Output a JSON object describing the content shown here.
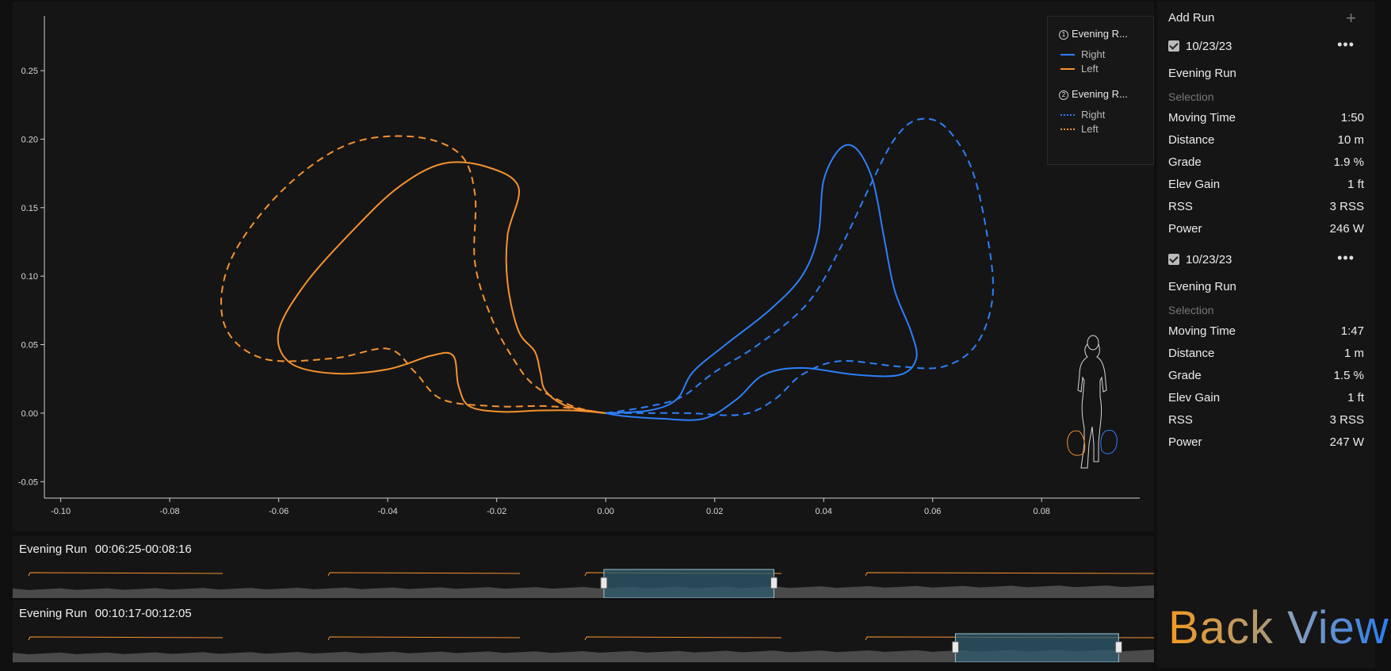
{
  "colors": {
    "right": "#2d7ff9",
    "left": "#f6922f",
    "background": "#0f0f10",
    "panel": "#151515"
  },
  "chart_data": {
    "type": "line",
    "xlim": [
      -0.103,
      0.098
    ],
    "ylim": [
      -0.062,
      0.29
    ],
    "x_ticks": [
      "-0.10",
      "-0.08",
      "-0.06",
      "-0.04",
      "-0.02",
      "0.00",
      "0.02",
      "0.04",
      "0.06",
      "0.08"
    ],
    "y_ticks": [
      "0.25",
      "0.20",
      "0.15",
      "0.10",
      "0.05",
      "0.00",
      "-0.05"
    ],
    "grid": false,
    "legend_position": "top-right",
    "series": [
      {
        "name": "Right",
        "group": "Evening R...",
        "run": 1,
        "dash": "solid",
        "color": "#2d7ff9",
        "points": [
          [
            0.0,
            0.0
          ],
          [
            0.008,
            0.002
          ],
          [
            0.013,
            0.01
          ],
          [
            0.016,
            0.03
          ],
          [
            0.022,
            0.05
          ],
          [
            0.03,
            0.075
          ],
          [
            0.036,
            0.1
          ],
          [
            0.039,
            0.13
          ],
          [
            0.04,
            0.17
          ],
          [
            0.043,
            0.193
          ],
          [
            0.046,
            0.193
          ],
          [
            0.049,
            0.17
          ],
          [
            0.051,
            0.13
          ],
          [
            0.053,
            0.09
          ],
          [
            0.056,
            0.06
          ],
          [
            0.057,
            0.04
          ],
          [
            0.054,
            0.028
          ],
          [
            0.046,
            0.028
          ],
          [
            0.036,
            0.033
          ],
          [
            0.029,
            0.028
          ],
          [
            0.024,
            0.01
          ],
          [
            0.018,
            -0.004
          ],
          [
            0.01,
            -0.004
          ],
          [
            0.003,
            -0.002
          ],
          [
            0.0,
            0.0
          ]
        ]
      },
      {
        "name": "Left",
        "group": "Evening R...",
        "run": 1,
        "dash": "solid",
        "color": "#f6922f",
        "points": [
          [
            0.0,
            0.0
          ],
          [
            -0.006,
            0.002
          ],
          [
            -0.012,
            0.002
          ],
          [
            -0.019,
            0.001
          ],
          [
            -0.025,
            0.005
          ],
          [
            -0.027,
            0.02
          ],
          [
            -0.028,
            0.042
          ],
          [
            -0.032,
            0.042
          ],
          [
            -0.04,
            0.032
          ],
          [
            -0.05,
            0.029
          ],
          [
            -0.058,
            0.037
          ],
          [
            -0.06,
            0.06
          ],
          [
            -0.055,
            0.095
          ],
          [
            -0.046,
            0.135
          ],
          [
            -0.038,
            0.165
          ],
          [
            -0.03,
            0.182
          ],
          [
            -0.022,
            0.18
          ],
          [
            -0.016,
            0.165
          ],
          [
            -0.018,
            0.13
          ],
          [
            -0.018,
            0.095
          ],
          [
            -0.016,
            0.06
          ],
          [
            -0.013,
            0.045
          ],
          [
            -0.012,
            0.03
          ],
          [
            -0.011,
            0.016
          ],
          [
            -0.007,
            0.005
          ],
          [
            0.0,
            0.0
          ]
        ]
      },
      {
        "name": "Right",
        "group": "Evening R...",
        "run": 2,
        "dash": "dashed",
        "color": "#2d7ff9",
        "points": [
          [
            0.0,
            0.0
          ],
          [
            0.008,
            0.005
          ],
          [
            0.014,
            0.012
          ],
          [
            0.02,
            0.03
          ],
          [
            0.028,
            0.05
          ],
          [
            0.037,
            0.08
          ],
          [
            0.043,
            0.12
          ],
          [
            0.049,
            0.17
          ],
          [
            0.053,
            0.2
          ],
          [
            0.057,
            0.214
          ],
          [
            0.062,
            0.21
          ],
          [
            0.067,
            0.18
          ],
          [
            0.07,
            0.13
          ],
          [
            0.071,
            0.085
          ],
          [
            0.068,
            0.05
          ],
          [
            0.062,
            0.034
          ],
          [
            0.054,
            0.034
          ],
          [
            0.043,
            0.038
          ],
          [
            0.036,
            0.028
          ],
          [
            0.031,
            0.01
          ],
          [
            0.025,
            -0.001
          ],
          [
            0.015,
            0.0
          ],
          [
            0.006,
            0.0
          ],
          [
            0.0,
            0.0
          ]
        ]
      },
      {
        "name": "Left",
        "group": "Evening R...",
        "run": 2,
        "dash": "dashed",
        "color": "#f6922f",
        "points": [
          [
            0.0,
            0.0
          ],
          [
            -0.01,
            0.005
          ],
          [
            -0.02,
            0.005
          ],
          [
            -0.03,
            0.01
          ],
          [
            -0.035,
            0.03
          ],
          [
            -0.04,
            0.047
          ],
          [
            -0.05,
            0.04
          ],
          [
            -0.063,
            0.04
          ],
          [
            -0.07,
            0.065
          ],
          [
            -0.069,
            0.11
          ],
          [
            -0.06,
            0.16
          ],
          [
            -0.048,
            0.195
          ],
          [
            -0.036,
            0.202
          ],
          [
            -0.027,
            0.19
          ],
          [
            -0.024,
            0.16
          ],
          [
            -0.024,
            0.11
          ],
          [
            -0.021,
            0.07
          ],
          [
            -0.017,
            0.04
          ],
          [
            -0.013,
            0.02
          ],
          [
            -0.006,
            0.005
          ],
          [
            0.0,
            0.0
          ]
        ]
      }
    ]
  },
  "legend": {
    "groups": [
      {
        "title": "Evening R...",
        "num": "1",
        "items": [
          "Right",
          "Left"
        ]
      },
      {
        "title": "Evening R...",
        "num": "2",
        "items": [
          "Right",
          "Left"
        ]
      }
    ]
  },
  "timelines": [
    {
      "name": "Evening Run",
      "range": "00:06:25-00:08:16",
      "selection_start": 0.518,
      "selection_end": 0.667
    },
    {
      "name": "Evening Run",
      "range": "00:10:17-00:12:05",
      "selection_start": 0.826,
      "selection_end": 0.969
    }
  ],
  "sidebar": {
    "add_run": "Add Run",
    "add_icon": "plus-icon",
    "menu_icon": "more-dots-icon",
    "runs": [
      {
        "date": "10/23/23",
        "name": "Evening Run",
        "selection": "Selection",
        "stats": [
          {
            "label": "Moving Time",
            "value": "1:50"
          },
          {
            "label": "Distance",
            "value": "10 m"
          },
          {
            "label": "Grade",
            "value": "1.9 %"
          },
          {
            "label": "Elev Gain",
            "value": "1 ft"
          },
          {
            "label": "RSS",
            "value": "3 RSS"
          },
          {
            "label": "Power",
            "value": "246 W"
          }
        ]
      },
      {
        "date": "10/23/23",
        "name": "Evening Run",
        "selection": "Selection",
        "stats": [
          {
            "label": "Moving Time",
            "value": "1:47"
          },
          {
            "label": "Distance",
            "value": "1 m"
          },
          {
            "label": "Grade",
            "value": "1.5 %"
          },
          {
            "label": "Elev Gain",
            "value": "1 ft"
          },
          {
            "label": "RSS",
            "value": "3 RSS"
          },
          {
            "label": "Power",
            "value": "247 W"
          }
        ]
      }
    ]
  },
  "brand": {
    "back": "Back",
    "view": "View"
  }
}
